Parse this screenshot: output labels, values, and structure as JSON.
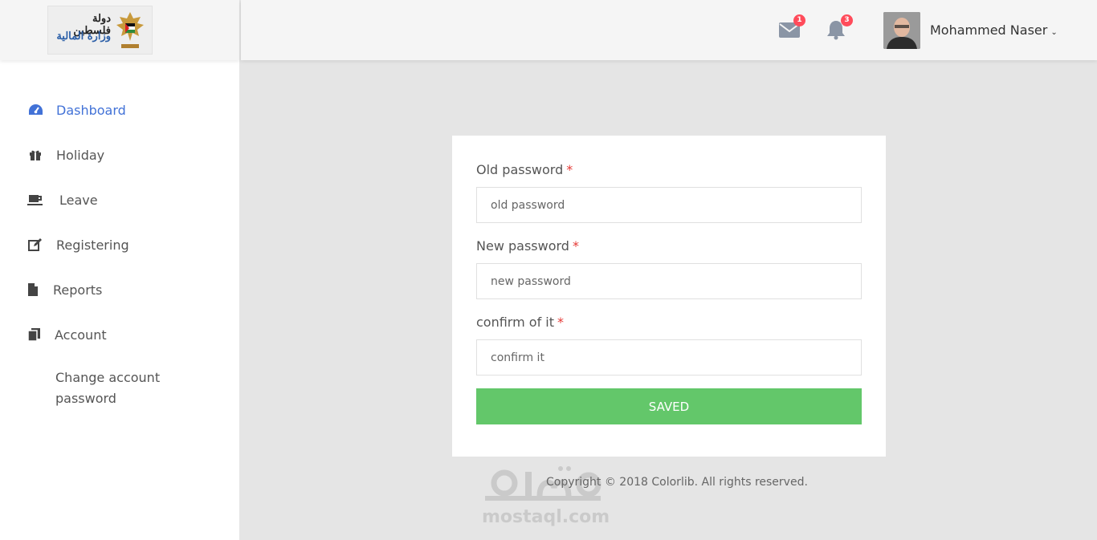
{
  "logo": {
    "line1": "دولة فلسطين",
    "line2": "وزارة المالية"
  },
  "sidebar": {
    "items": [
      {
        "label": "Dashboard",
        "icon": "dashboard-icon",
        "active": true
      },
      {
        "label": "Holiday",
        "icon": "gift-icon"
      },
      {
        "label": "Leave",
        "icon": "coffee-cup-icon"
      },
      {
        "label": "Registering",
        "icon": "edit-icon"
      },
      {
        "label": "Reports",
        "icon": "file-icon"
      },
      {
        "label": "Account",
        "icon": "copy-icon"
      }
    ],
    "sub_item": "Change account password"
  },
  "header": {
    "mail_count": "1",
    "notification_count": "3",
    "user_name": "Mohammed Naser"
  },
  "form": {
    "old_label": "Old password",
    "old_placeholder": "old password",
    "new_label": "New password",
    "new_placeholder": "new password",
    "confirm_label": "confirm of it",
    "confirm_placeholder": "confirm it",
    "required_mark": "*",
    "submit_label": "SAVED"
  },
  "footer": {
    "copyright": "Copyright © 2018 Colorlib. All rights reserved.",
    "watermark": "mostaql.com"
  },
  "colors": {
    "accent": "#4272d7",
    "button": "#63c76a",
    "badge": "#ff4b5a",
    "required": "#e53935"
  }
}
